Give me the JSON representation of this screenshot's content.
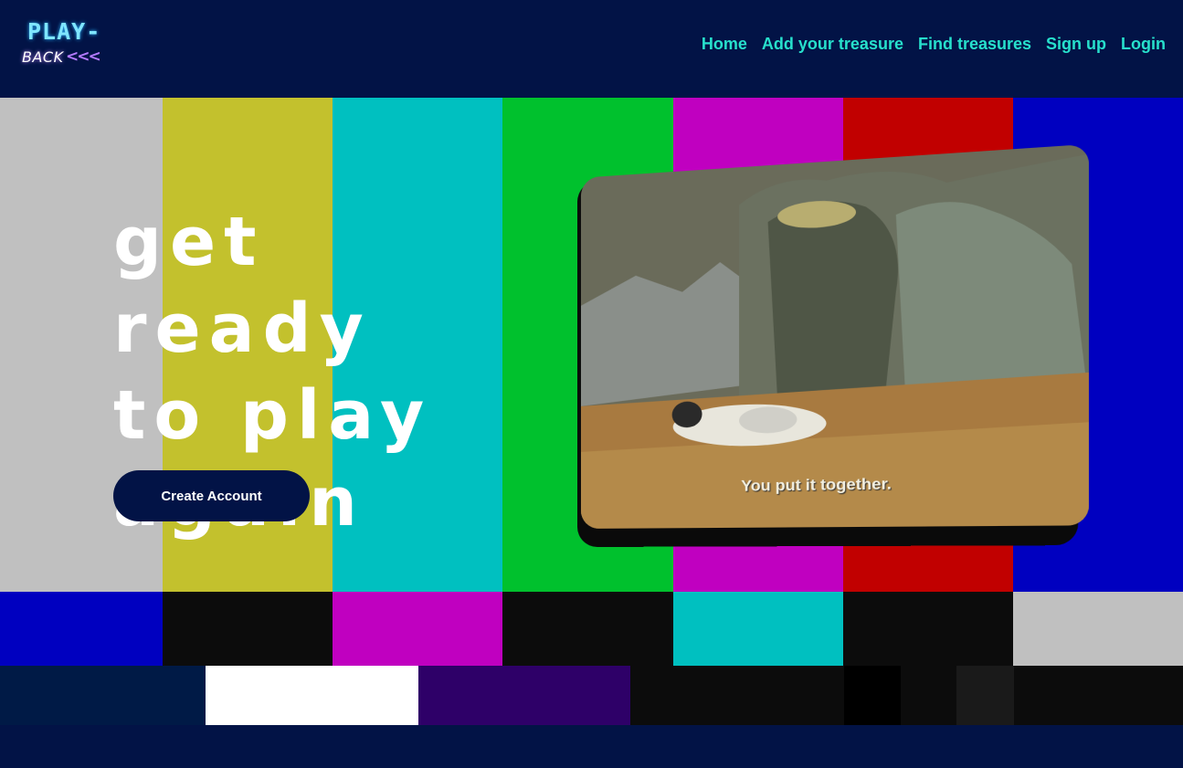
{
  "header": {
    "logo_top": "PLAY-",
    "logo_bottom": "BACK",
    "logo_arrows": "<<<",
    "nav": {
      "home": "Home",
      "add": "Add your treasure",
      "find": "Find treasures",
      "signup": "Sign up",
      "login": "Login"
    }
  },
  "hero": {
    "headline_line1": "get ready",
    "headline_line2": "to play",
    "headline_line3": "again",
    "cta_label": "Create Account"
  },
  "video": {
    "caption": "You put it together."
  },
  "colors": {
    "navy": "#021346",
    "accent": "#27e0cc",
    "bars_top": [
      "#c0c0c0",
      "#c3c12d",
      "#00c0c0",
      "#00c12d",
      "#c000c0",
      "#c10000",
      "#0000c0"
    ],
    "bars_mid": [
      "#0000c0",
      "#0c0c0c",
      "#c000c0",
      "#0c0c0c",
      "#00c0c0",
      "#0c0c0c",
      "#c0c0c0"
    ],
    "bars_bottom": [
      "#001a46",
      "#ffffff",
      "#2e0068",
      "#0c0c0c",
      "#000000",
      "#0c0c0c",
      "#1a1a1a",
      "#0c0c0c"
    ]
  }
}
